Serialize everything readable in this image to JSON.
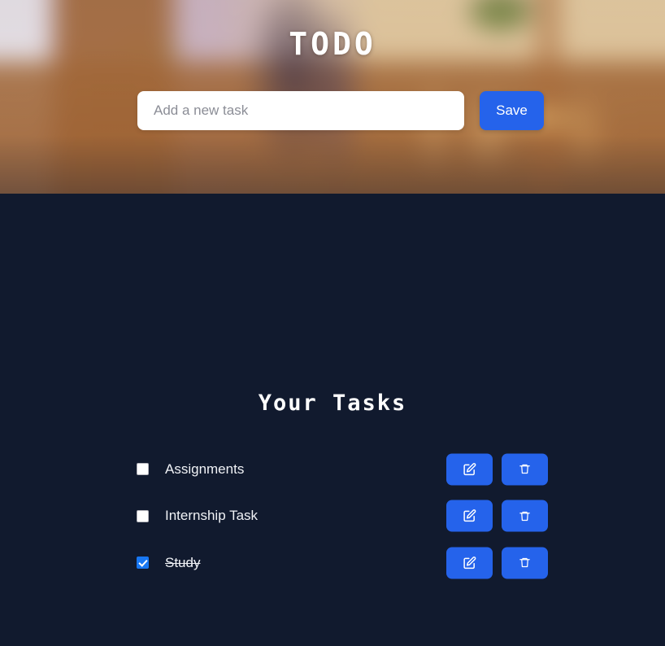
{
  "header": {
    "title": "TODO",
    "background_description": "blurred interior kitchen and dining room photo",
    "input": {
      "placeholder": "Add a new task",
      "value": ""
    },
    "save_label": "Save"
  },
  "tasks_section": {
    "heading": "Your Tasks",
    "items": [
      {
        "label": "Assignments",
        "completed": false,
        "edit_icon": "edit-pencil-icon",
        "delete_icon": "trash-icon"
      },
      {
        "label": "Internship Task",
        "completed": false,
        "edit_icon": "edit-pencil-icon",
        "delete_icon": "trash-icon"
      },
      {
        "label": "Study",
        "completed": true,
        "edit_icon": "edit-pencil-icon",
        "delete_icon": "trash-icon"
      }
    ]
  },
  "colors": {
    "accent_blue": "#2563eb",
    "checkbox_blue": "#1877f2",
    "dark_background": "#111a2e",
    "text_primary": "#f0f2f6",
    "placeholder": "#8b8d96",
    "input_background": "#ffffff"
  }
}
